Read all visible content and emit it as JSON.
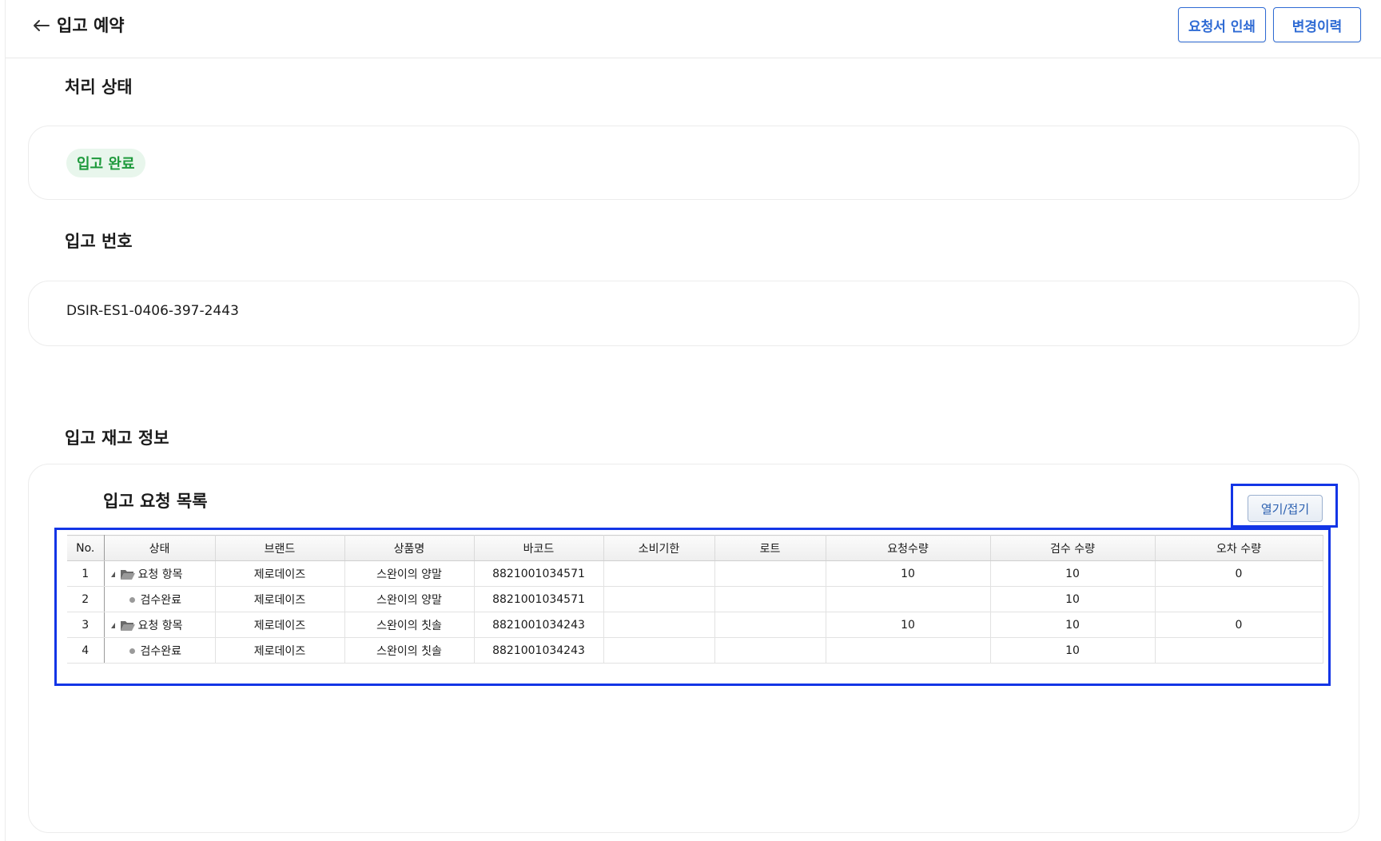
{
  "header": {
    "title": "입고 예약",
    "print_button": "요청서 인쇄",
    "history_button": "변경이력"
  },
  "status_section": {
    "title": "처리 상태",
    "badge": "입고 완료",
    "badge_color": "#1e9a3c"
  },
  "number_section": {
    "title": "입고 번호",
    "value": "DSIR-ES1-0406-397-2443"
  },
  "stock_section": {
    "title": "입고 재고 정보",
    "list_title": "입고 요청 목록",
    "toggle_button": "열기/접기",
    "columns": [
      "No.",
      "상태",
      "브랜드",
      "상품명",
      "바코드",
      "소비기한",
      "로트",
      "요청수량",
      "검수 수량",
      "오차 수량"
    ],
    "rows": [
      {
        "no": "1",
        "status": "요청 항목",
        "kind": "folder",
        "brand": "제로데이즈",
        "product": "스완이의 양말",
        "barcode": "8821001034571",
        "expiry": "",
        "lot": "",
        "requested": "10",
        "inspected": "10",
        "diff": "0"
      },
      {
        "no": "2",
        "status": "검수완료",
        "kind": "leaf",
        "brand": "제로데이즈",
        "product": "스완이의 양말",
        "barcode": "8821001034571",
        "expiry": "",
        "lot": "",
        "requested": "",
        "inspected": "10",
        "diff": ""
      },
      {
        "no": "3",
        "status": "요청 항목",
        "kind": "folder",
        "brand": "제로데이즈",
        "product": "스완이의 칫솔",
        "barcode": "8821001034243",
        "expiry": "",
        "lot": "",
        "requested": "10",
        "inspected": "10",
        "diff": "0"
      },
      {
        "no": "4",
        "status": "검수완료",
        "kind": "leaf",
        "brand": "제로데이즈",
        "product": "스완이의 칫솔",
        "barcode": "8821001034243",
        "expiry": "",
        "lot": "",
        "requested": "",
        "inspected": "10",
        "diff": ""
      }
    ]
  },
  "colors": {
    "accent": "#2f6bd4",
    "highlight_frame": "#1335e6"
  }
}
